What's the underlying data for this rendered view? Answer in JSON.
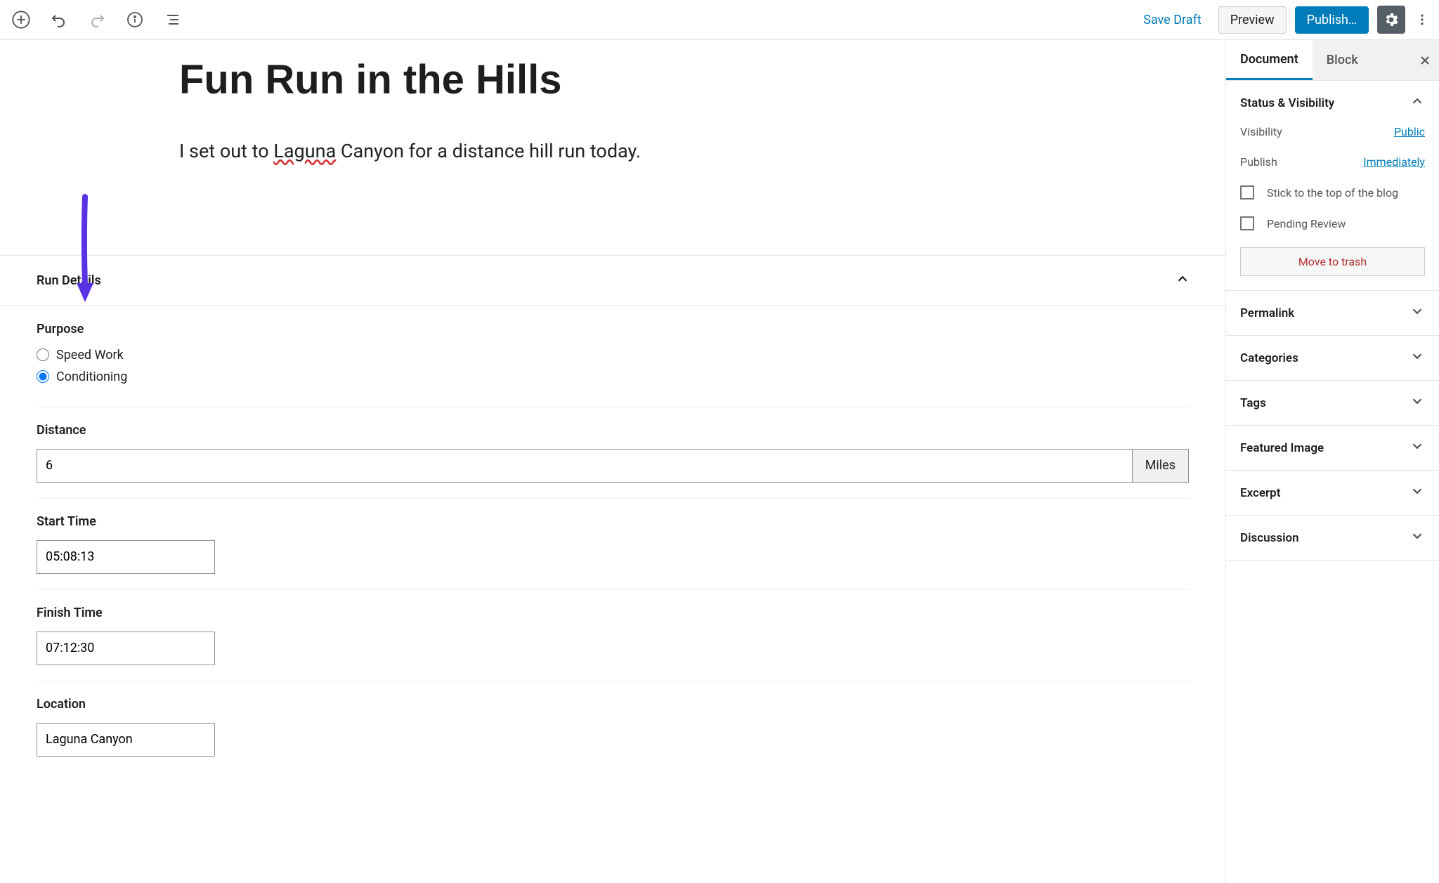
{
  "toolbar": {
    "save_draft": "Save Draft",
    "preview": "Preview",
    "publish": "Publish…"
  },
  "post": {
    "title": "Fun Run in the Hills",
    "body_pre": "I set out to ",
    "body_spell": "Laguna",
    "body_post": " Canyon for a distance hill run today."
  },
  "metabox": {
    "title": "Run Details",
    "purpose": {
      "label": "Purpose",
      "options": [
        "Speed Work",
        "Conditioning"
      ],
      "selected": "Conditioning"
    },
    "distance": {
      "label": "Distance",
      "value": "6",
      "unit": "Miles"
    },
    "start": {
      "label": "Start Time",
      "value": "05:08:13"
    },
    "finish": {
      "label": "Finish Time",
      "value": "07:12:30"
    },
    "location": {
      "label": "Location",
      "value": "Laguna Canyon"
    }
  },
  "sidebar": {
    "tabs": {
      "document": "Document",
      "block": "Block"
    },
    "status": {
      "title": "Status & Visibility",
      "visibility_label": "Visibility",
      "visibility_value": "Public",
      "publish_label": "Publish",
      "publish_value": "Immediately",
      "stick": "Stick to the top of the blog",
      "pending": "Pending Review",
      "trash": "Move to trash"
    },
    "panels": {
      "permalink": "Permalink",
      "categories": "Categories",
      "tags": "Tags",
      "featured": "Featured Image",
      "excerpt": "Excerpt",
      "discussion": "Discussion"
    }
  }
}
